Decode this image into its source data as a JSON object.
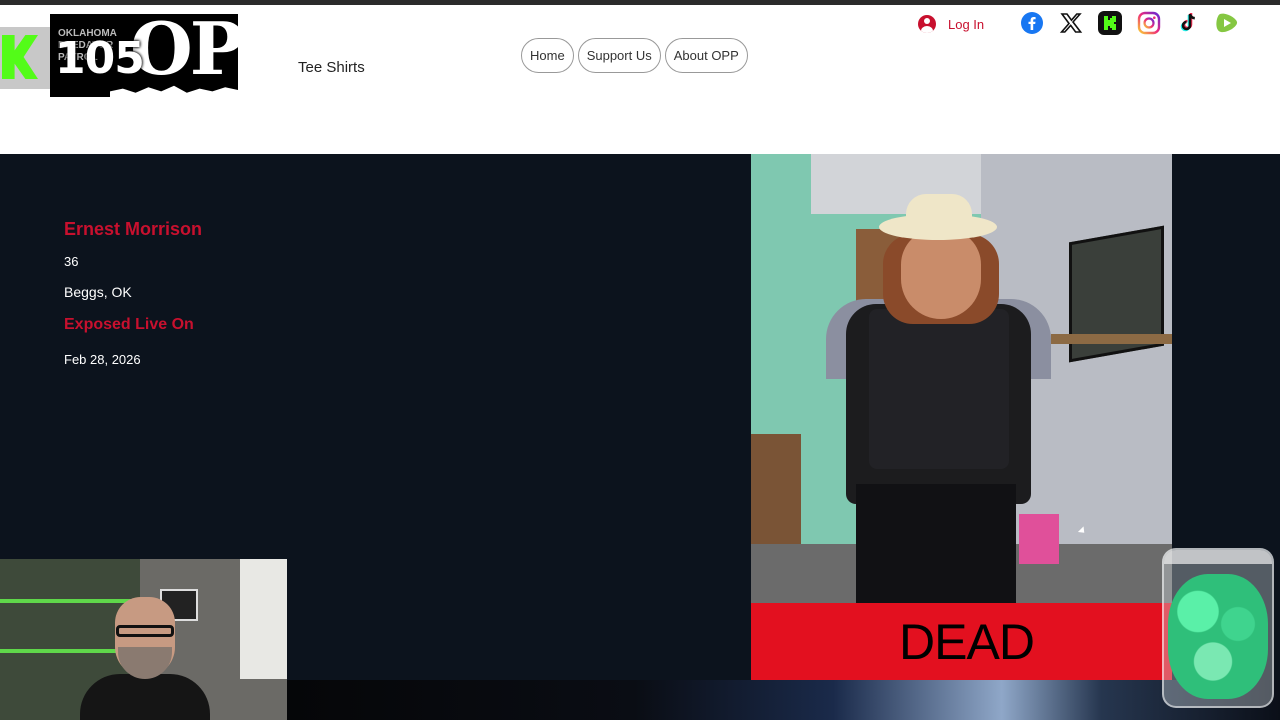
{
  "header": {
    "overlay_counter": "105",
    "logo_text": "OPP",
    "logo_subtext": "OKLAHOMA PREDATOR PATROL",
    "tee_shirts": "Tee Shirts",
    "nav": [
      {
        "label": "Home"
      },
      {
        "label": "Support Us"
      },
      {
        "label": "About OPP"
      }
    ],
    "login_label": "Log In",
    "socials": [
      "facebook-icon",
      "x-icon",
      "kick-icon",
      "instagram-icon",
      "tiktok-icon",
      "rumble-icon"
    ]
  },
  "profile": {
    "name": "Ernest Morrison",
    "age": "36",
    "location": "Beggs, OK",
    "exposed_heading": "Exposed Live On",
    "exposed_date": "Feb 28, 2026",
    "status_banner": "DEAD"
  },
  "colors": {
    "accent_red": "#c8102e",
    "main_bg": "#0c131d",
    "banner_red": "#e3101f",
    "kick_green": "#53fc18"
  }
}
